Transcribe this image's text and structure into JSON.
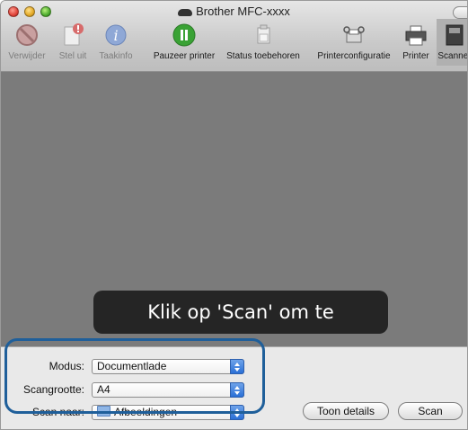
{
  "window": {
    "title": "Brother MFC-xxxx"
  },
  "toolbar": {
    "items": [
      {
        "label": "Verwijder",
        "icon": "delete-icon",
        "enabled": false
      },
      {
        "label": "Stel uit",
        "icon": "hold-icon",
        "enabled": false
      },
      {
        "label": "Taakinfo",
        "icon": "info-icon",
        "enabled": false
      },
      {
        "label": "Pauzeer printer",
        "icon": "pause-icon",
        "enabled": true
      },
      {
        "label": "Status toebehoren",
        "icon": "supplies-icon",
        "enabled": true
      },
      {
        "label": "Printerconfiguratie",
        "icon": "printer-setup-icon",
        "enabled": true
      },
      {
        "label": "Printer",
        "icon": "printer-icon",
        "enabled": true
      },
      {
        "label": "Scanner",
        "icon": "scanner-icon",
        "enabled": true
      }
    ]
  },
  "preview": {
    "message": "Klik op 'Scan' om te beginnen..."
  },
  "settings": {
    "modus_label": "Modus:",
    "modus_value": "Documentlade",
    "scangrootte_label": "Scangrootte:",
    "scangrootte_value": "A4",
    "scan_naar_label": "Scan naar:",
    "scan_naar_value": "Afbeeldingen"
  },
  "buttons": {
    "details_label": "Toon details",
    "scan_label": "Scan"
  },
  "colors": {
    "preview_bg": "#7b7b7b",
    "highlight_border": "#1f5f9a",
    "select_arrow": "#2a6fd6",
    "pause_green": "#3aa235"
  }
}
